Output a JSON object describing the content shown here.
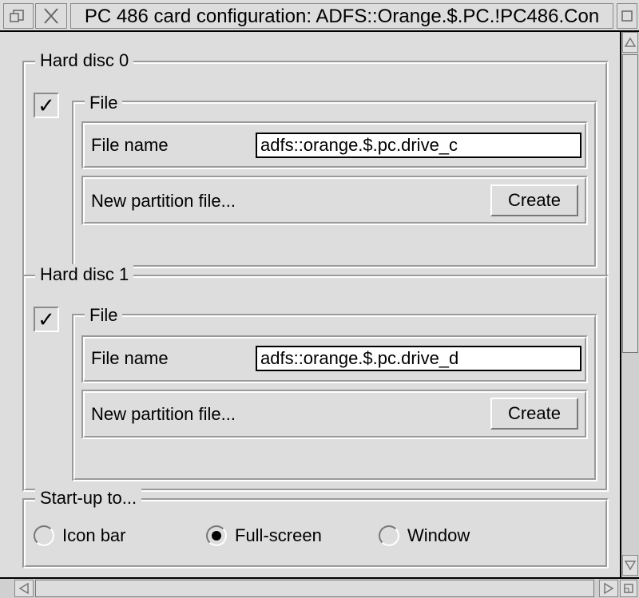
{
  "window": {
    "title": "PC 486 card configuration: ADFS::Orange.$.PC.!PC486.Con"
  },
  "icons": {
    "back": "back-icon",
    "close": "close-icon",
    "toggle_size": "toggle-size-icon",
    "scroll_up": "scroll-up-arrow-icon",
    "scroll_down": "scroll-down-arrow-icon",
    "scroll_left": "scroll-left-arrow-icon",
    "scroll_right": "scroll-right-arrow-icon",
    "resize": "resize-icon",
    "tick": "checkmark-icon"
  },
  "hard_disc_0": {
    "label": "Hard disc 0",
    "enabled_mark": "✓",
    "file_label": "File",
    "file_name_label": "File name",
    "file_name_value": "adfs::orange.$.pc.drive_c",
    "new_partition_label": "New partition file...",
    "create_label": "Create"
  },
  "hard_disc_1": {
    "label": "Hard disc 1",
    "enabled_mark": "✓",
    "file_label": "File",
    "file_name_label": "File name",
    "file_name_value": "adfs::orange.$.pc.drive_d",
    "new_partition_label": "New partition file...",
    "create_label": "Create"
  },
  "startup": {
    "label": "Start-up to...",
    "options": [
      {
        "label": "Icon bar",
        "selected": false
      },
      {
        "label": "Full-screen",
        "selected": true
      },
      {
        "label": "Window",
        "selected": false
      }
    ]
  }
}
